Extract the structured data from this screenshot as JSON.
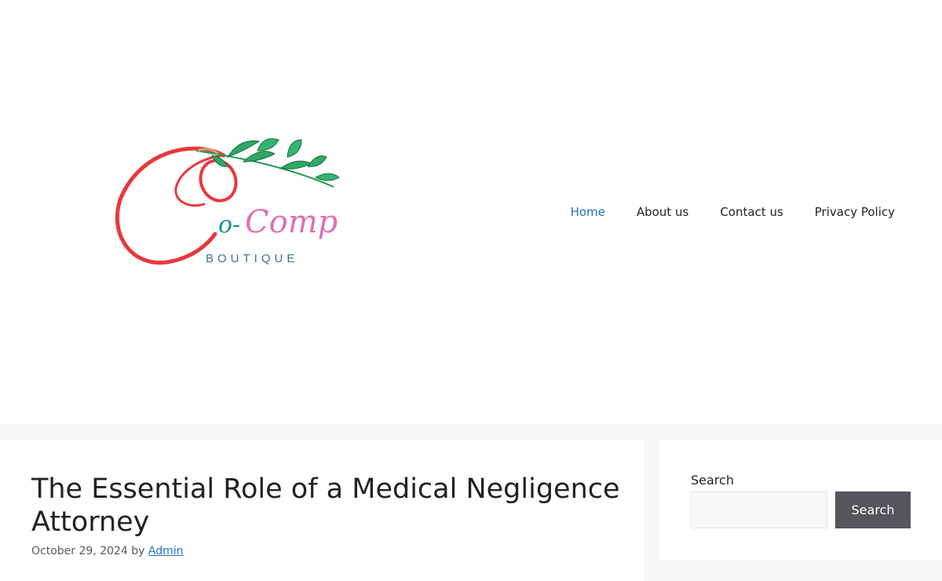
{
  "header": {
    "logo": {
      "script_text": "o-Comp",
      "tagline": "BOUTIQUE",
      "colors": {
        "red": "#e8383b",
        "teal": "#1a8f95",
        "pink": "#e06fb5",
        "leaf": "#1e9a52",
        "tagline": "#3d7388"
      }
    },
    "nav": [
      {
        "label": "Home",
        "active": true
      },
      {
        "label": "About us",
        "active": false
      },
      {
        "label": "Contact us",
        "active": false
      },
      {
        "label": "Privacy Policy",
        "active": false
      }
    ]
  },
  "post": {
    "title": "The Essential Role of a Medical Negligence Attorney",
    "date": "October 29, 2024",
    "by": "by",
    "author": "Admin"
  },
  "sidebar": {
    "search": {
      "label": "Search",
      "value": "",
      "button_label": "Search"
    }
  },
  "colors": {
    "accent": "#1e72bd",
    "button_bg": "#55555e",
    "page_bg": "#f6f7f9"
  }
}
